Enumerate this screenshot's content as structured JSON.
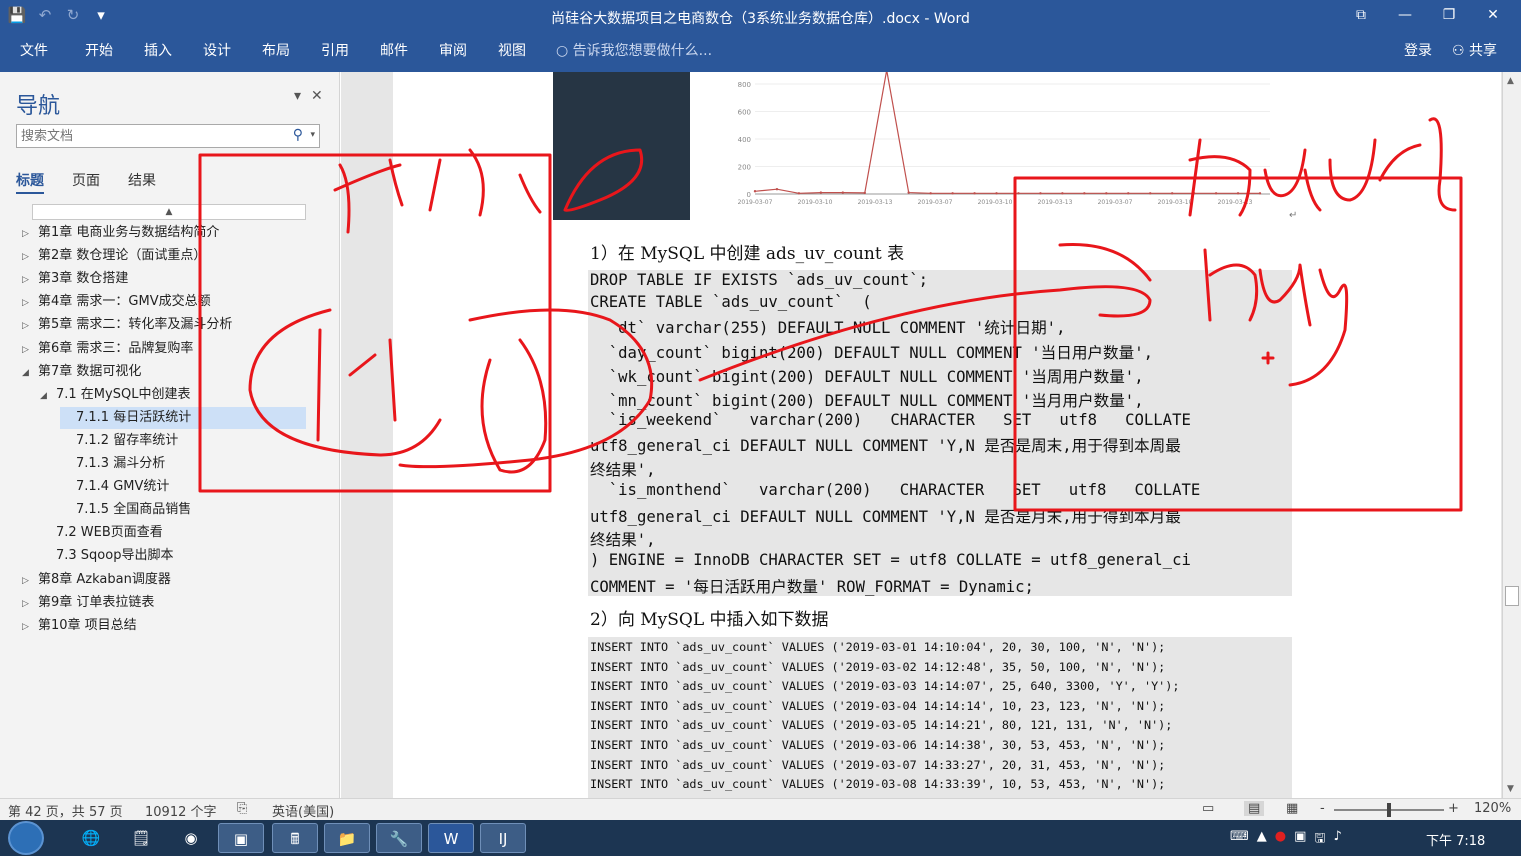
{
  "window": {
    "title": "尚硅谷大数据项目之电商数仓（3系统业务数据仓库）.docx - Word",
    "controls": [
      "⧉",
      "—",
      "❐",
      "✕"
    ]
  },
  "qat": {
    "save": "💾",
    "undo": "↶",
    "redo": "↻",
    "more": "▾"
  },
  "ribbon": {
    "tabs": [
      "文件",
      "开始",
      "插入",
      "设计",
      "布局",
      "引用",
      "邮件",
      "审阅",
      "视图"
    ],
    "tell_me": "告诉我您想要做什么...",
    "login": "登录",
    "share": "共享"
  },
  "nav": {
    "title": "导航",
    "search_placeholder": "搜索文档",
    "tabs": [
      "标题",
      "页面",
      "结果"
    ],
    "items": [
      {
        "label": "第1章 电商业务与数据结构简介",
        "level": 1,
        "toggle": "▷"
      },
      {
        "label": "第2章 数仓理论（面试重点）",
        "level": 1,
        "toggle": "▷"
      },
      {
        "label": "第3章 数仓搭建",
        "level": 1,
        "toggle": "▷"
      },
      {
        "label": "第4章 需求一：GMV成交总额",
        "level": 1,
        "toggle": "▷"
      },
      {
        "label": "第5章 需求二：转化率及漏斗分析",
        "level": 1,
        "toggle": "▷"
      },
      {
        "label": "第6章 需求三：品牌复购率",
        "level": 1,
        "toggle": "▷"
      },
      {
        "label": "第7章 数据可视化",
        "level": 1,
        "toggle": "◢"
      },
      {
        "label": "7.1 在MySQL中创建表",
        "level": 2,
        "toggle": "◢"
      },
      {
        "label": "7.1.1 每日活跃统计",
        "level": 3,
        "toggle": "",
        "selected": true
      },
      {
        "label": "7.1.2 留存率统计",
        "level": 3,
        "toggle": ""
      },
      {
        "label": "7.1.3 漏斗分析",
        "level": 3,
        "toggle": ""
      },
      {
        "label": "7.1.4  GMV统计",
        "level": 3,
        "toggle": ""
      },
      {
        "label": "7.1.5 全国商品销售",
        "level": 3,
        "toggle": ""
      },
      {
        "label": "7.2 WEB页面查看",
        "level": 2,
        "toggle": ""
      },
      {
        "label": "7.3 Sqoop导出脚本",
        "level": 2,
        "toggle": ""
      },
      {
        "label": "第8章 Azkaban调度器",
        "level": 1,
        "toggle": "▷"
      },
      {
        "label": "第9章 订单表拉链表",
        "level": 1,
        "toggle": "▷"
      },
      {
        "label": "第10章 项目总结",
        "level": 1,
        "toggle": "▷"
      }
    ]
  },
  "chart_data": {
    "type": "line",
    "x": [
      "2019-03-07",
      "2019-03-10",
      "2019-03-13",
      "2019-03-07",
      "2019-03-10",
      "2019-03-13",
      "2019-03-07",
      "2019-03-10",
      "2019-03-13"
    ],
    "yticks": [
      "800",
      "600",
      "400",
      "200",
      "0"
    ],
    "ylim": [
      0,
      800
    ],
    "series": [
      {
        "values": [
          20,
          35,
          5,
          10,
          10,
          8,
          900,
          10,
          5,
          5,
          5,
          5,
          5,
          5,
          5,
          5,
          5,
          5,
          5,
          5,
          5,
          5,
          5,
          5
        ],
        "color": "#c0504d"
      }
    ]
  },
  "doc": {
    "heading1": "1）在 MySQL 中创建 ads_uv_count 表",
    "code_lines": [
      "DROP TABLE IF EXISTS `ads_uv_count`;",
      "CREATE TABLE `ads_uv_count`  (",
      "  `dt` varchar(255) DEFAULT NULL COMMENT '统计日期',",
      "  `day_count` bigint(200) DEFAULT NULL COMMENT '当日用户数量',",
      "  `wk_count` bigint(200) DEFAULT NULL COMMENT '当周用户数量',",
      "  `mn_count` bigint(200) DEFAULT NULL COMMENT '当月用户数量',",
      "  `is_weekend`   varchar(200)   CHARACTER   SET   utf8   COLLATE",
      "utf8_general_ci DEFAULT NULL COMMENT 'Y,N 是否是周末,用于得到本周最",
      "终结果',",
      "  `is_monthend`   varchar(200)   CHARACTER   SET   utf8   COLLATE",
      "utf8_general_ci DEFAULT NULL COMMENT 'Y,N 是否是月末,用于得到本月最",
      "终结果',",
      ") ENGINE = InnoDB CHARACTER SET = utf8 COLLATE = utf8_general_ci",
      "COMMENT = '每日活跃用户数量' ROW_FORMAT = Dynamic;"
    ],
    "heading2": "2）向 MySQL 中插入如下数据",
    "insert_lines": [
      "INSERT INTO `ads_uv_count` VALUES ('2019-03-01 14:10:04', 20, 30, 100, 'N', 'N');",
      "INSERT INTO `ads_uv_count` VALUES ('2019-03-02 14:12:48', 35, 50, 100, 'N', 'N');",
      "INSERT INTO `ads_uv_count` VALUES ('2019-03-03 14:14:07', 25, 640, 3300, 'Y', 'Y');",
      "INSERT INTO `ads_uv_count` VALUES ('2019-03-04 14:14:14', 10, 23, 123, 'N', 'N');",
      "INSERT INTO `ads_uv_count` VALUES ('2019-03-05 14:14:21', 80, 121, 131, 'N', 'N');",
      "INSERT INTO `ads_uv_count` VALUES ('2019-03-06 14:14:38', 30, 53, 453, 'N', 'N');",
      "INSERT INTO `ads_uv_count` VALUES ('2019-03-07 14:33:27', 20, 31, 453, 'N', 'N');",
      "INSERT INTO `ads_uv_count` VALUES ('2019-03-08 14:33:39', 10, 53, 453, 'N', 'N');"
    ]
  },
  "status": {
    "page": "第 42 页，共 57 页",
    "words": "10912 个字",
    "lang": "英语(美国)",
    "zoom": "120%",
    "zoom_minus": "-",
    "zoom_plus": "+",
    "zoom_level": 0.5
  },
  "taskbar": {
    "apps": [
      "🌐",
      "🗒",
      "◉",
      "▣",
      "🖩",
      "📁",
      "🔧",
      "W",
      "IJ"
    ],
    "clock": "下午 7:18",
    "tray": [
      "⌨",
      "▲",
      "●",
      "▣",
      "🖫",
      "♪"
    ]
  }
}
